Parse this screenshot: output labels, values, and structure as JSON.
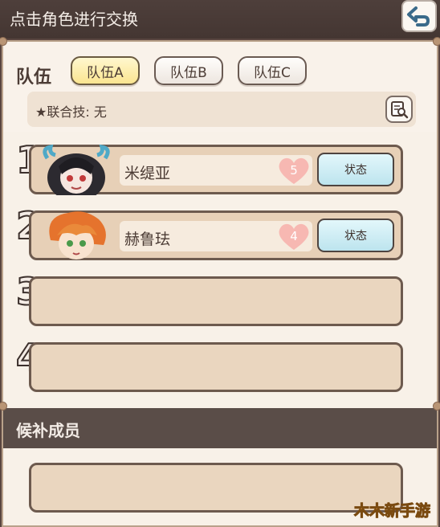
{
  "header": {
    "title": "点击角色进行交换"
  },
  "team": {
    "label": "队伍",
    "tabs": [
      {
        "label": "队伍A",
        "active": true
      },
      {
        "label": "队伍B",
        "active": false
      },
      {
        "label": "队伍C",
        "active": false
      }
    ],
    "combo_skill": "★联合技: 无"
  },
  "slots": [
    {
      "number": "1",
      "name": "米缇亚",
      "level": "5",
      "status_label": "状态"
    },
    {
      "number": "2",
      "name": "赫鲁珐",
      "level": "4",
      "status_label": "状态"
    },
    {
      "number": "3"
    },
    {
      "number": "4"
    }
  ],
  "bench": {
    "title": "候补成员"
  },
  "watermark": "木木新手游",
  "colors": {
    "active_tab": "#fbe590",
    "status_button": "#bde4ee",
    "heart": "#f7b8b2",
    "header_bg": "#4e3f3b"
  }
}
